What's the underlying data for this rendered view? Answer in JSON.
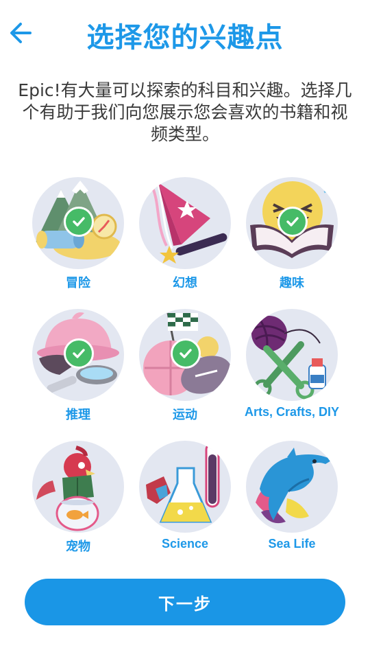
{
  "header": {
    "title": "选择您的兴趣点",
    "back_icon": "arrow-left-icon"
  },
  "description": "Epic!有大量可以探索的科目和兴趣。选择几个有助于我们向您展示您会喜欢的书籍和视频类型。",
  "colors": {
    "accent": "#1d98e8",
    "check": "#46bb67",
    "button": "#1a96e6",
    "tile_bg": "#e3e7f1"
  },
  "interests": [
    {
      "label": "冒险",
      "icon": "adventure-icon",
      "selected": true
    },
    {
      "label": "幻想",
      "icon": "fantasy-icon",
      "selected": false
    },
    {
      "label": "趣味",
      "icon": "fun-icon",
      "selected": true
    },
    {
      "label": "推理",
      "icon": "mystery-icon",
      "selected": true
    },
    {
      "label": "运动",
      "icon": "sports-icon",
      "selected": true
    },
    {
      "label": "Arts, Crafts, DIY",
      "icon": "arts-crafts-icon",
      "selected": false
    },
    {
      "label": "宠物",
      "icon": "pets-icon",
      "selected": false
    },
    {
      "label": "Science",
      "icon": "science-icon",
      "selected": false
    },
    {
      "label": "Sea Life",
      "icon": "sea-life-icon",
      "selected": false
    }
  ],
  "next_button": {
    "label": "下一步"
  }
}
